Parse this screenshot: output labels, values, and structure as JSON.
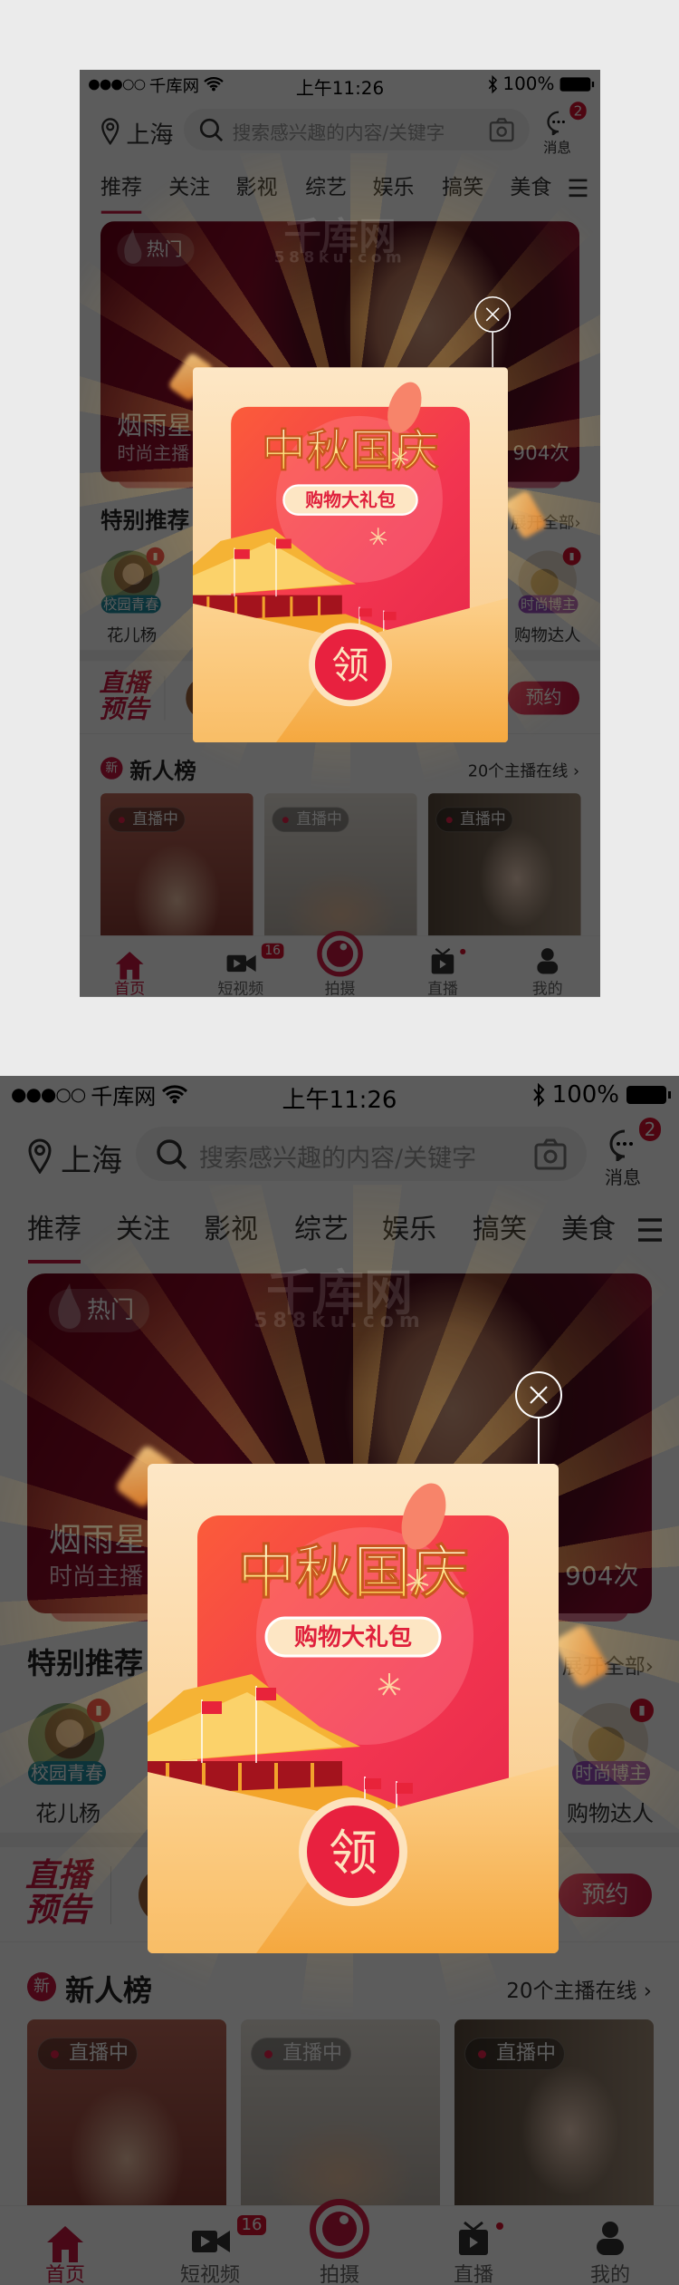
{
  "status_bar": {
    "signal": "●●●○○",
    "carrier": "千库网",
    "time": "上午11:26",
    "battery": "100%"
  },
  "header": {
    "location": "上海",
    "search_placeholder": "搜索感兴趣的内容/关键字",
    "message_label": "消息",
    "message_badge": "2"
  },
  "tabs": [
    {
      "label": "推荐",
      "active": true
    },
    {
      "label": "关注"
    },
    {
      "label": "影视"
    },
    {
      "label": "综艺"
    },
    {
      "label": "娱乐"
    },
    {
      "label": "搞笑"
    },
    {
      "label": "美食"
    }
  ],
  "banner": {
    "tag": "热门",
    "title": "烟雨星",
    "subtitle": "时尚主播",
    "count": "904次"
  },
  "featured": {
    "title": "特别推荐",
    "more": "展开全部",
    "anchors": [
      {
        "tag": "校园青春",
        "name": "花儿杨",
        "tag_color": "#1f8fa0"
      },
      {
        "tag": "时尚博主",
        "name": "购物达人",
        "tag_color": "#9b4fc0"
      }
    ]
  },
  "live_preview": {
    "line1": "直播",
    "line2": "预告",
    "button": "预约"
  },
  "new_list": {
    "badge": "新",
    "title": "新人榜",
    "online": "20个主播在线",
    "cards": [
      {
        "status": "直播中"
      },
      {
        "status": "直播中"
      },
      {
        "status": "直播中"
      }
    ]
  },
  "tab_bar": {
    "items": [
      {
        "label": "首页",
        "icon": "home-icon",
        "active": true
      },
      {
        "label": "短视频",
        "icon": "video-camera-icon",
        "badge": "16"
      },
      {
        "label": "拍摄",
        "icon": "capture-icon"
      },
      {
        "label": "直播",
        "icon": "tv-icon",
        "dot": true
      },
      {
        "label": "我的",
        "icon": "user-icon"
      }
    ]
  },
  "popup": {
    "title": "中秋国庆",
    "subtitle": "购物大礼包",
    "claim": "领"
  },
  "watermark": {
    "brand": "千库网",
    "url": "588ku.com"
  },
  "colors": {
    "accent": "#c8173f",
    "popup_red": "#f0304f",
    "gold": "#f5c24a",
    "envelope": "#f7b455",
    "overlay": "rgba(0,0,0,0.66)"
  }
}
